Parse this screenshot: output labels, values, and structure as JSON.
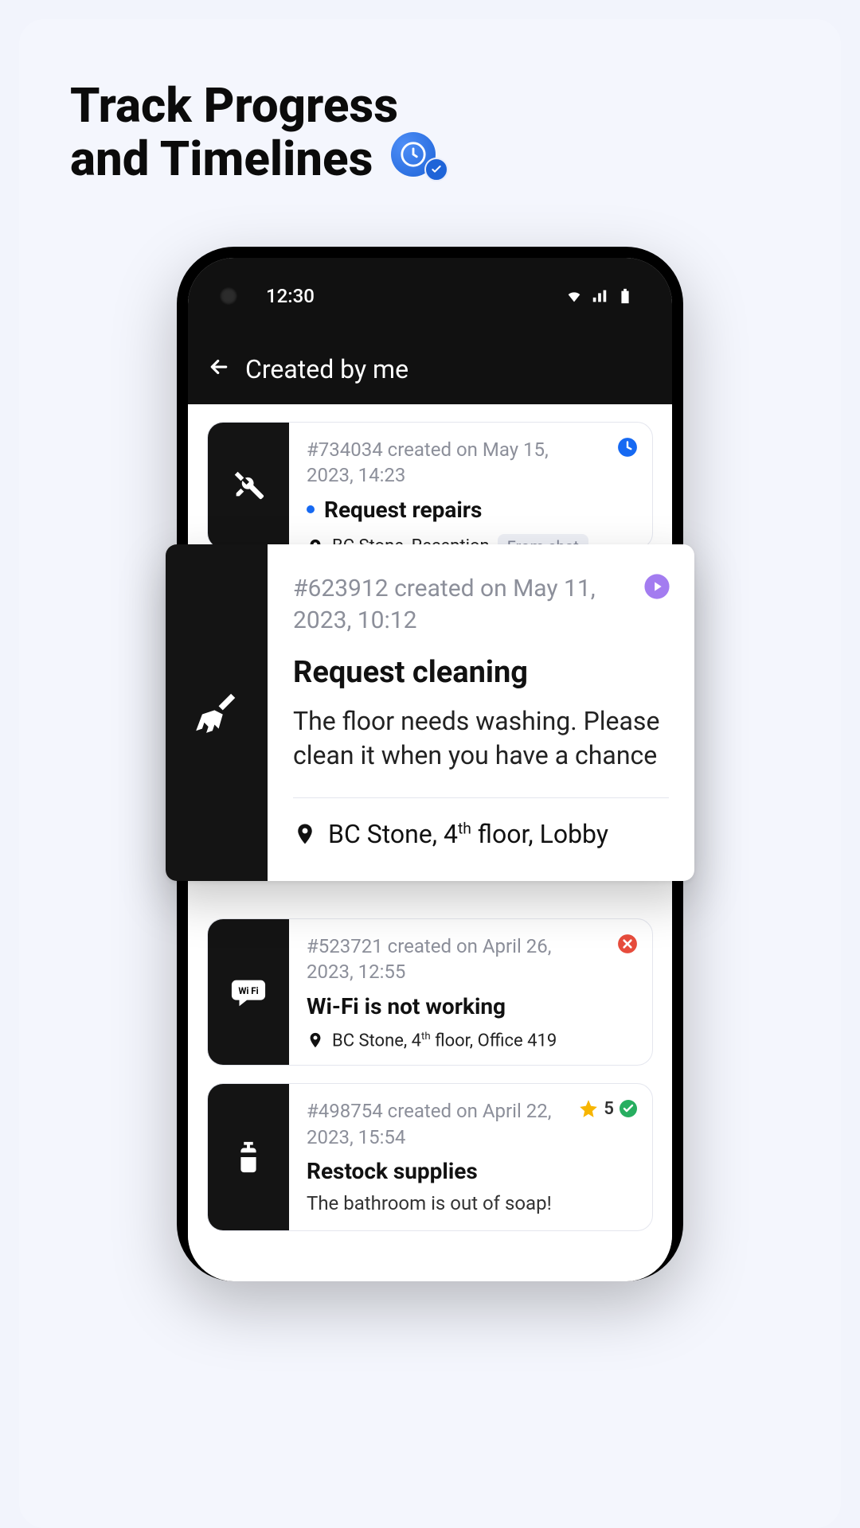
{
  "page": {
    "heading_line1": "Track Progress",
    "heading_line2": "and Timelines"
  },
  "status_bar": {
    "time": "12:30"
  },
  "app_bar": {
    "title": "Created by me"
  },
  "tickets": [
    {
      "id_line": "#734034 created on May 15, 2023, 14:23",
      "title": "Request repairs",
      "location": "BC Stone, Reception",
      "chip": "From chat",
      "status": "clock",
      "has_blue_dot": true,
      "icon": "tools"
    },
    {
      "id_line": "#623912 created on May 11, 2023, 10:12",
      "title": "Request cleaning",
      "description": "The floor needs washing. Please clean it when you have a chance",
      "location_pre": "BC Stone, 4",
      "location_sup": "th",
      "location_post": " floor, Lobby",
      "status": "play",
      "icon": "broom"
    },
    {
      "id_line": "#523721 created on April 26, 2023, 12:55",
      "title": "Wi-Fi is not working",
      "location_pre": "BC Stone, 4",
      "location_sup": "th",
      "location_post": " floor, Office 419",
      "status": "cancel",
      "icon": "wifi"
    },
    {
      "id_line": "#498754 created on April 22, 2023, 15:54",
      "title": "Restock supplies",
      "description": "The bathroom is out of soap!",
      "rating": "5",
      "status": "done",
      "icon": "soap"
    }
  ]
}
